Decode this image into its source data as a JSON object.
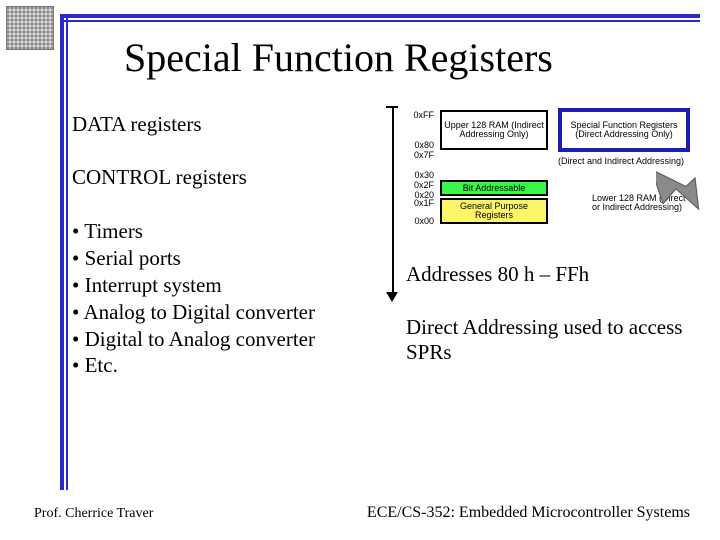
{
  "title": "Special Function Registers",
  "left": {
    "data_heading": "DATA registers",
    "control_heading": "CONTROL registers",
    "bullets": {
      "b0": "Timers",
      "b1": "Serial ports",
      "b2": "Interrupt system",
      "b3": "Analog to Digital converter",
      "b4": "Digital to Analog converter",
      "b5": "Etc."
    }
  },
  "right": {
    "addresses": "Addresses 80 h – FFh",
    "direct": "Direct Addressing used to access SPRs"
  },
  "fig": {
    "upper": "Upper 128 RAM\n(Indirect Addressing Only)",
    "sfr": "Special Function Registers\n(Direct Addressing Only)",
    "di": "(Direct and Indirect Addressing)",
    "bitaddr": "Bit Addressable",
    "gpr": "General Purpose Registers",
    "lower_note": "Lower 128 RAM\n(Direct or Indirect Addressing)",
    "addr": {
      "ff": "0xFF",
      "a80": "0x80",
      "a7f": "0x7F",
      "a30": "0x30",
      "a2f": "0x2F",
      "a20": "0x20",
      "a1f": "0x1F",
      "a00": "0x00"
    }
  },
  "footer": {
    "left": "Prof. Cherrice Traver",
    "right": "ECE/CS-352: Embedded Microcontroller Systems"
  }
}
